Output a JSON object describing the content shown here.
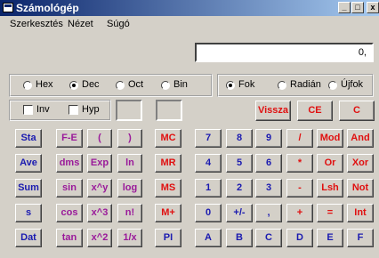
{
  "window": {
    "title": "Számológép",
    "min_glyph": "_",
    "max_glyph": "□",
    "close_glyph": "x"
  },
  "menu": {
    "items": [
      "Szerkesztés",
      "Nézet",
      "Súgó"
    ]
  },
  "display": {
    "value": "0,"
  },
  "number_system": {
    "options": [
      "Hex",
      "Dec",
      "Oct",
      "Bin"
    ],
    "selected": "Dec"
  },
  "angle_mode": {
    "options": [
      "Fok",
      "Radián",
      "Újfok"
    ],
    "selected": "Fok"
  },
  "checkboxes": {
    "inv": "Inv",
    "hyp": "Hyp"
  },
  "edit_keys": {
    "backspace": "Vissza",
    "clear_entry": "CE",
    "clear": "C"
  },
  "stat_keys": [
    "Sta",
    "Ave",
    "Sum",
    "s",
    "Dat"
  ],
  "sci_keys": [
    [
      "F-E",
      "(",
      ")"
    ],
    [
      "dms",
      "Exp",
      "ln"
    ],
    [
      "sin",
      "x^y",
      "log"
    ],
    [
      "cos",
      "x^3",
      "n!"
    ],
    [
      "tan",
      "x^2",
      "1/x"
    ]
  ],
  "memory_keys": [
    "MC",
    "MR",
    "MS",
    "M+",
    "PI"
  ],
  "number_pad": [
    [
      "7",
      "8",
      "9",
      "/",
      "Mod",
      "And"
    ],
    [
      "4",
      "5",
      "6",
      "*",
      "Or",
      "Xor"
    ],
    [
      "1",
      "2",
      "3",
      "-",
      "Lsh",
      "Not"
    ],
    [
      "0",
      "+/-",
      ",",
      "+",
      "=",
      "Int"
    ],
    [
      "A",
      "B",
      "C",
      "D",
      "E",
      "F"
    ]
  ],
  "colors": {
    "blue": "#1b1bb0",
    "purple": "#9a1a9a",
    "red": "#e01010",
    "face": "#d4d0c8"
  }
}
